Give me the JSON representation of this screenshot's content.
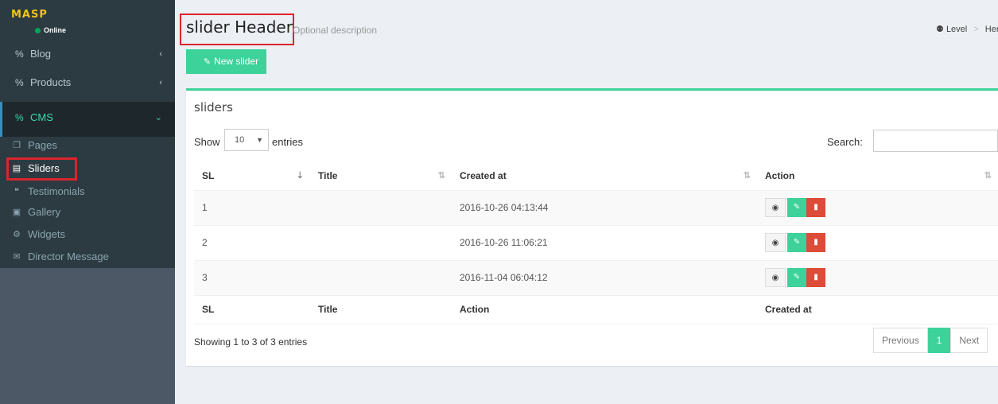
{
  "brand": {
    "logo_text": "MASP",
    "status": "Online"
  },
  "sidebar": {
    "items": [
      {
        "label": "Blog",
        "icon": "link-icon",
        "chevron": "‹"
      },
      {
        "label": "Products",
        "icon": "link-icon",
        "chevron": "‹"
      },
      {
        "label": "CMS",
        "icon": "link-icon",
        "chevron": "⌄"
      }
    ],
    "sub_items": [
      {
        "label": "Pages",
        "icon": "copy-icon"
      },
      {
        "label": "Sliders",
        "icon": "file-icon"
      },
      {
        "label": "Testimonials",
        "icon": "quote-icon"
      },
      {
        "label": "Gallery",
        "icon": "image-icon"
      },
      {
        "label": "Widgets",
        "icon": "cogs-icon"
      },
      {
        "label": "Director Message",
        "icon": "envelope-icon"
      }
    ]
  },
  "header": {
    "title": "slider Header",
    "description": "Optional description",
    "breadcrumb": {
      "level": "Level",
      "here": "Her"
    }
  },
  "toolbar": {
    "new_label": "New slider"
  },
  "box": {
    "title": "sliders",
    "show_label": "Show",
    "entries_value": "10",
    "entries_label": "entries",
    "search_label": "Search:"
  },
  "table": {
    "headers": [
      "SL",
      "Title",
      "Created at",
      "Action"
    ],
    "rows": [
      {
        "sl": "1",
        "title": "",
        "created": "2016-10-26 04:13:44"
      },
      {
        "sl": "2",
        "title": "",
        "created": "2016-10-26 11:06:21"
      },
      {
        "sl": "3",
        "title": "",
        "created": "2016-11-04 06:04:12"
      }
    ],
    "footers": [
      "SL",
      "Title",
      "Action",
      "Created at"
    ]
  },
  "footer": {
    "info": "Showing 1 to 3 of 3 entries",
    "prev": "Previous",
    "page": "1",
    "next": "Next"
  },
  "colors": {
    "accent": "#3dd29a",
    "danger": "#dd4b39",
    "highlight": "#d9252c"
  }
}
